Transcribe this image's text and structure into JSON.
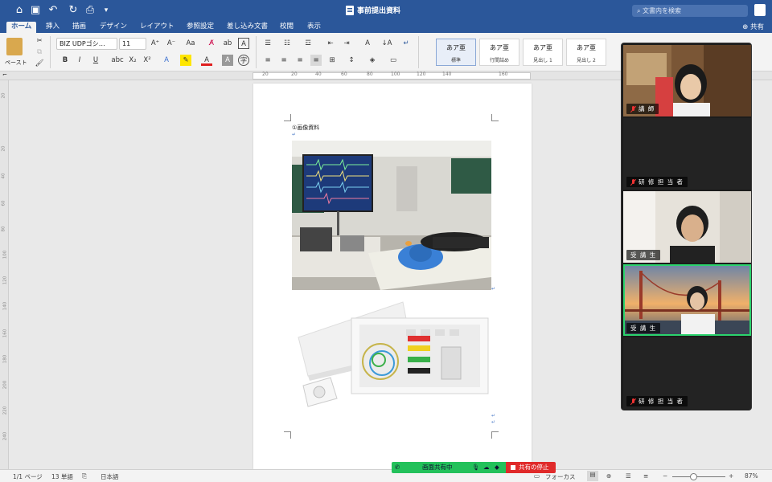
{
  "titlebar": {
    "doc_title": "事前提出資料",
    "search_placeholder": "文書内を検索"
  },
  "menu": {
    "tabs": [
      "ホーム",
      "挿入",
      "描画",
      "デザイン",
      "レイアウト",
      "参照設定",
      "差し込み文書",
      "校閲",
      "表示"
    ],
    "active_tab": "ホーム",
    "share_label": "共有"
  },
  "ribbon": {
    "paste_label": "ペースト",
    "font_name": "BIZ UDPゴシ…",
    "font_size": "11",
    "styles": [
      {
        "preview": "あア亜",
        "name": "標準"
      },
      {
        "preview": "あア亜",
        "name": "行間詰め"
      },
      {
        "preview": "あア亜",
        "name": "見出し 1"
      },
      {
        "preview": "あア亜",
        "name": "見出し 2"
      }
    ]
  },
  "ruler": {
    "h_numbers": [
      "20",
      "20",
      "40",
      "60",
      "80",
      "100",
      "120",
      "140",
      "160"
    ],
    "v_numbers": [
      "20",
      "20",
      "40",
      "60",
      "80",
      "100",
      "120",
      "140",
      "160",
      "180",
      "200",
      "220",
      "240"
    ]
  },
  "document": {
    "heading": "①画像資料",
    "para_mark": "↵"
  },
  "statusbar": {
    "page": "1/1 ページ",
    "words": "13 単語",
    "language": "日本語",
    "focus": "フォーカス",
    "zoom": "87%"
  },
  "share": {
    "sharing_label": "画面共有中",
    "stop_label": "共有の停止"
  },
  "video": {
    "participants": [
      {
        "label": "講 師",
        "muted": true
      },
      {
        "label": "研 修 担 当 者",
        "muted": true
      },
      {
        "label": "受 講 生",
        "muted": false
      },
      {
        "label": "受 講 生",
        "muted": false
      },
      {
        "label": "研 修 担 当 者",
        "muted": true
      }
    ]
  },
  "colors": {
    "word_blue": "#2b579a",
    "share_green": "#23c15b",
    "stop_red": "#e02a2a",
    "active_speaker": "#2bd36d"
  }
}
